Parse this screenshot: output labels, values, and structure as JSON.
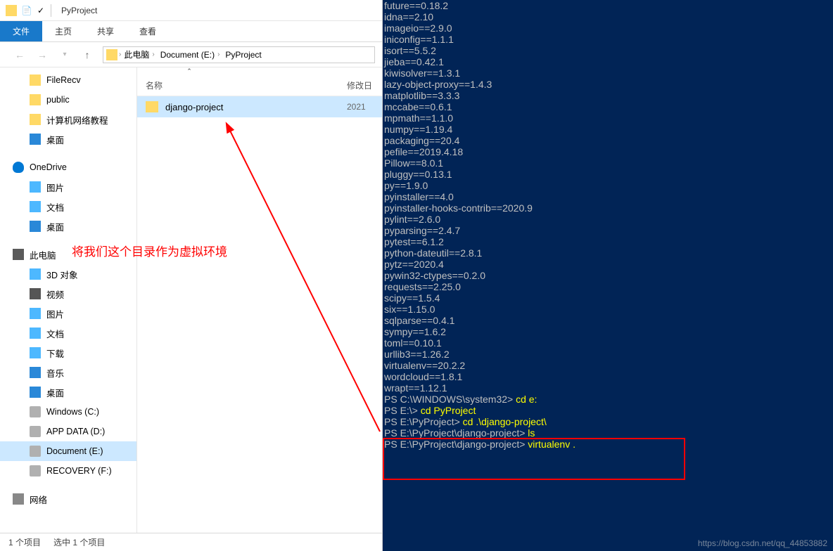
{
  "titlebar": {
    "title": "PyProject"
  },
  "ribbon": {
    "file": "文件",
    "home": "主页",
    "share": "共享",
    "view": "查看"
  },
  "breadcrumb": {
    "segs": [
      "此电脑",
      "Document (E:)",
      "PyProject"
    ]
  },
  "tree": {
    "items": [
      {
        "label": "FileRecv",
        "icon": "ti-folder",
        "indent": true
      },
      {
        "label": "public",
        "icon": "ti-folder",
        "indent": true
      },
      {
        "label": "计算机网络教程",
        "icon": "ti-folder",
        "indent": true
      },
      {
        "label": "桌面",
        "icon": "ti-desktop",
        "indent": true
      },
      {
        "gap": true
      },
      {
        "label": "OneDrive",
        "icon": "ti-cloud",
        "indent": false
      },
      {
        "label": "图片",
        "icon": "ti-pic",
        "indent": true
      },
      {
        "label": "文档",
        "icon": "ti-doc",
        "indent": true
      },
      {
        "label": "桌面",
        "icon": "ti-desktop",
        "indent": true
      },
      {
        "gap": true
      },
      {
        "label": "此电脑",
        "icon": "ti-pc",
        "indent": false
      },
      {
        "label": "3D 对象",
        "icon": "ti-3d",
        "indent": true
      },
      {
        "label": "视频",
        "icon": "ti-video",
        "indent": true
      },
      {
        "label": "图片",
        "icon": "ti-pic",
        "indent": true
      },
      {
        "label": "文档",
        "icon": "ti-doc",
        "indent": true
      },
      {
        "label": "下载",
        "icon": "ti-down",
        "indent": true
      },
      {
        "label": "音乐",
        "icon": "ti-music",
        "indent": true
      },
      {
        "label": "桌面",
        "icon": "ti-desktop",
        "indent": true
      },
      {
        "label": "Windows (C:)",
        "icon": "ti-drive",
        "indent": true
      },
      {
        "label": "APP DATA (D:)",
        "icon": "ti-drive",
        "indent": true
      },
      {
        "label": "Document (E:)",
        "icon": "ti-drive",
        "indent": true,
        "selected": true
      },
      {
        "label": "RECOVERY (F:)",
        "icon": "ti-drive",
        "indent": true
      },
      {
        "gap": true
      },
      {
        "label": "网络",
        "icon": "ti-net",
        "indent": false
      }
    ]
  },
  "filelist": {
    "col_name": "名称",
    "col_date": "修改日",
    "rows": [
      {
        "name": "django-project",
        "date": "2021",
        "selected": true
      }
    ]
  },
  "status": {
    "count": "1 个项目",
    "sel": "选中 1 个项目"
  },
  "annotation": "将我们这个目录作为虚拟环境",
  "terminal": {
    "packages": [
      "future==0.18.2",
      "idna==2.10",
      "imageio==2.9.0",
      "iniconfig==1.1.1",
      "isort==5.5.2",
      "jieba==0.42.1",
      "kiwisolver==1.3.1",
      "lazy-object-proxy==1.4.3",
      "matplotlib==3.3.3",
      "mccabe==0.6.1",
      "mpmath==1.1.0",
      "numpy==1.19.4",
      "packaging==20.4",
      "pefile==2019.4.18",
      "Pillow==8.0.1",
      "pluggy==0.13.1",
      "py==1.9.0",
      "pyinstaller==4.0",
      "pyinstaller-hooks-contrib==2020.9",
      "pylint==2.6.0",
      "pyparsing==2.4.7",
      "pytest==6.1.2",
      "python-dateutil==2.8.1",
      "pytz==2020.4",
      "pywin32-ctypes==0.2.0",
      "requests==2.25.0",
      "scipy==1.5.4",
      "six==1.15.0",
      "sqlparse==0.4.1",
      "sympy==1.6.2",
      "toml==0.10.1",
      "urllib3==1.26.2",
      "virtualenv==20.2.2",
      "wordcloud==1.8.1",
      "wrapt==1.12.1"
    ],
    "prompts": [
      {
        "p": "PS C:\\WINDOWS\\system32> ",
        "c": "cd e:"
      },
      {
        "p": "PS E:\\> ",
        "c": "cd PyProject"
      },
      {
        "p": "PS E:\\PyProject> ",
        "c": "cd .\\django-project\\"
      },
      {
        "p": "PS E:\\PyProject\\django-project> ",
        "c": "ls"
      },
      {
        "p": "PS E:\\PyProject\\django-project> ",
        "c": "virtualenv ."
      }
    ]
  },
  "watermark": "https://blog.csdn.net/qq_44853882"
}
